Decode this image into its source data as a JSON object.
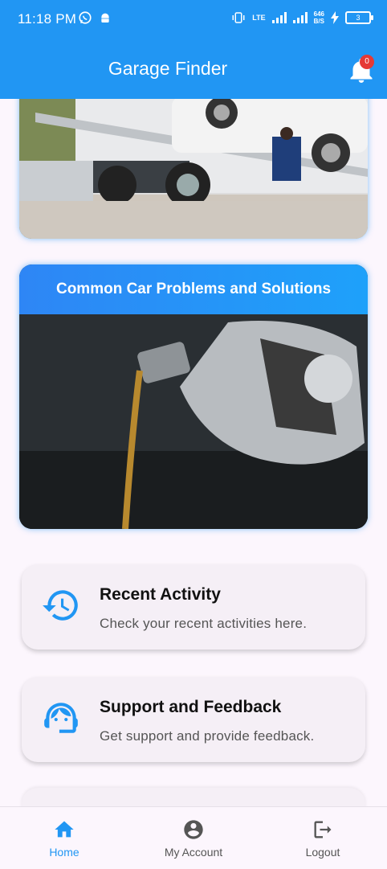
{
  "status_bar": {
    "time": "11:18 PM",
    "network": "LTE",
    "speed_value": "646",
    "speed_unit": "B/S",
    "battery": "3"
  },
  "app_bar": {
    "title": "Garage Finder",
    "notification_count": "0"
  },
  "cards": [
    {
      "title": "",
      "image": "tow-truck-photo"
    },
    {
      "title": "Common Car Problems and Solutions",
      "image": "engine-oil-pour-photo"
    }
  ],
  "menu": [
    {
      "title": "Recent Activity",
      "subtitle": "Check your recent activities here.",
      "icon": "history-icon"
    },
    {
      "title": "Support and Feedback",
      "subtitle": "Get support and provide feedback.",
      "icon": "support-agent-icon"
    }
  ],
  "bottom_nav": [
    {
      "label": "Home",
      "icon": "home-icon",
      "active": true
    },
    {
      "label": "My Account",
      "icon": "account-icon",
      "active": false
    },
    {
      "label": "Logout",
      "icon": "logout-icon",
      "active": false
    }
  ],
  "colors": {
    "primary": "#2196F3",
    "background": "#FCF6FD",
    "card": "#F5EFF6",
    "badge": "#E53935"
  }
}
